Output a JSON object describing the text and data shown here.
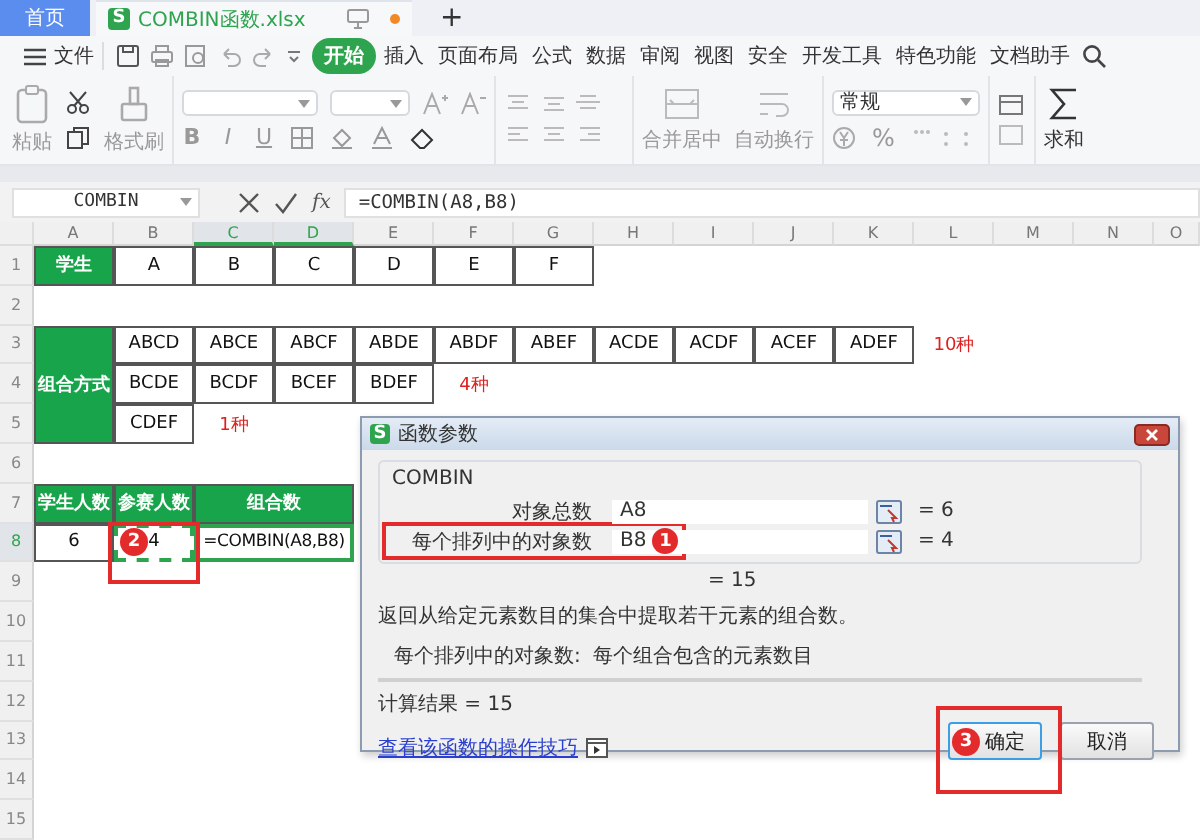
{
  "tabs": [
    {
      "label": "首页",
      "kind": "home",
      "selected": false
    },
    {
      "label": "COMBIN函数.xlsx",
      "kind": "file",
      "icon_text": "S",
      "selected": true,
      "unsaved": true
    }
  ],
  "new_tab": "+",
  "menu": {
    "file": "文件",
    "items": [
      {
        "label": "开始",
        "selected": true
      },
      {
        "label": "插入",
        "selected": false
      },
      {
        "label": "页面布局",
        "selected": false
      },
      {
        "label": "公式",
        "selected": false
      },
      {
        "label": "数据",
        "selected": false
      },
      {
        "label": "审阅",
        "selected": false
      },
      {
        "label": "视图",
        "selected": false
      },
      {
        "label": "安全",
        "selected": false
      },
      {
        "label": "开发工具",
        "selected": false
      },
      {
        "label": "特色功能",
        "selected": false
      },
      {
        "label": "文档助手",
        "selected": false
      }
    ]
  },
  "ribbon": {
    "paste": "粘贴",
    "format_painter": "格式刷",
    "format_buttons": [
      "B",
      "I",
      "U"
    ],
    "merge": "合并居中",
    "wrap": "自动换行",
    "number_format": "常规",
    "percent": "%",
    "sum": "求和"
  },
  "formula_bar": {
    "name_box": "COMBIN",
    "fx": "fx",
    "formula": "=COMBIN(A8,B8)"
  },
  "sheet": {
    "columns": [
      {
        "label": "A",
        "selected": false
      },
      {
        "label": "B",
        "selected": false
      },
      {
        "label": "C",
        "selected": true
      },
      {
        "label": "D",
        "selected": true
      },
      {
        "label": "E",
        "selected": false
      },
      {
        "label": "F",
        "selected": false
      },
      {
        "label": "G",
        "selected": false
      },
      {
        "label": "H",
        "selected": false
      },
      {
        "label": "I",
        "selected": false
      },
      {
        "label": "J",
        "selected": false
      },
      {
        "label": "K",
        "selected": false
      },
      {
        "label": "L",
        "selected": false
      },
      {
        "label": "M",
        "selected": false
      },
      {
        "label": "N",
        "selected": false
      },
      {
        "label": "O",
        "selected": false
      }
    ],
    "rows": [
      {
        "number": "1",
        "selected": false,
        "cells": [
          {
            "text": "学生",
            "kind": "header"
          },
          {
            "text": "A",
            "kind": "bordered"
          },
          {
            "text": "B",
            "kind": "bordered"
          },
          {
            "text": "C",
            "kind": "bordered"
          },
          {
            "text": "D",
            "kind": "bordered"
          },
          {
            "text": "E",
            "kind": "bordered"
          },
          {
            "text": "F",
            "kind": "bordered"
          }
        ]
      },
      {
        "number": "2",
        "selected": false,
        "cells": []
      },
      {
        "number": "3",
        "selected": false,
        "cells": [
          {
            "kind": "covered"
          },
          {
            "text": "ABCD",
            "kind": "bordered"
          },
          {
            "text": "ABCE",
            "kind": "bordered"
          },
          {
            "text": "ABCF",
            "kind": "bordered"
          },
          {
            "text": "ABDE",
            "kind": "bordered"
          },
          {
            "text": "ABDF",
            "kind": "bordered"
          },
          {
            "text": "ABEF",
            "kind": "bordered"
          },
          {
            "text": "ACDE",
            "kind": "bordered"
          },
          {
            "text": "ACDF",
            "kind": "bordered"
          },
          {
            "text": "ACEF",
            "kind": "bordered"
          },
          {
            "text": "ADEF",
            "kind": "bordered"
          },
          {
            "text": "10种",
            "kind": "note"
          }
        ]
      },
      {
        "number": "4",
        "selected": false,
        "cells": [
          {
            "text": "组合方式",
            "kind": "header_tall"
          },
          {
            "text": "BCDE",
            "kind": "bordered"
          },
          {
            "text": "BCDF",
            "kind": "bordered"
          },
          {
            "text": "BCEF",
            "kind": "bordered"
          },
          {
            "text": "BDEF",
            "kind": "bordered"
          },
          {
            "text": "4种",
            "kind": "note"
          }
        ]
      },
      {
        "number": "5",
        "selected": false,
        "cells": [
          {
            "kind": "covered"
          },
          {
            "text": "CDEF",
            "kind": "bordered"
          },
          {
            "text": "1种",
            "kind": "note"
          }
        ]
      },
      {
        "number": "6",
        "selected": false,
        "cells": []
      },
      {
        "number": "7",
        "selected": false,
        "cells": [
          {
            "text": "学生人数",
            "kind": "header"
          },
          {
            "text": "参赛人数",
            "kind": "header"
          },
          {
            "text": "组合数",
            "kind": "header_wide"
          }
        ]
      },
      {
        "number": "8",
        "selected": true,
        "cells": [
          {
            "text": "6",
            "kind": "bordered"
          },
          {
            "text": "4",
            "kind": "marquee",
            "annotation": "2"
          },
          {
            "text": "=COMBIN(A8,B8)",
            "kind": "active_wide"
          }
        ]
      },
      {
        "number": "9",
        "selected": false,
        "cells": []
      },
      {
        "number": "10",
        "selected": false,
        "cells": []
      },
      {
        "number": "11",
        "selected": false,
        "cells": []
      },
      {
        "number": "12",
        "selected": false,
        "cells": []
      },
      {
        "number": "13",
        "selected": false,
        "cells": []
      },
      {
        "number": "14",
        "selected": false,
        "cells": []
      },
      {
        "number": "15",
        "selected": false,
        "cells": []
      }
    ]
  },
  "dialog": {
    "icon_text": "S",
    "title": "函数参数",
    "function": "COMBIN",
    "args": [
      {
        "label": "对象总数",
        "value": "A8",
        "result": "= 6"
      },
      {
        "label": "每个排列中的对象数",
        "value": "B8",
        "result": "= 4",
        "annotation": "1"
      }
    ],
    "result": "= 15",
    "description": "返回从给定元素数目的集合中提取若干元素的组合数。",
    "arg_help": {
      "label": "每个排列中的对象数:",
      "text": "每个组合包含的元素数目"
    },
    "calc": "计算结果 = 15",
    "link": "查看该函数的操作技巧",
    "buttons": [
      {
        "label": "确定",
        "focused": true,
        "annotation": "3"
      },
      {
        "label": "取消",
        "focused": false
      }
    ]
  }
}
